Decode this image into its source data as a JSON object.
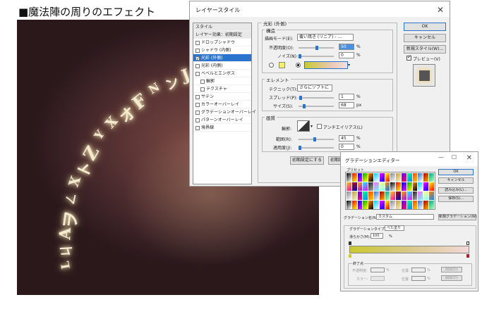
{
  "heading": "■魔法陣の周りのエフェクト",
  "photo": {
    "runes": [
      "L",
      "ㄐ",
      "A",
      "ヲ",
      "ㄥ",
      "X",
      "ト",
      "Z",
      "Y",
      "X",
      "オ",
      "F",
      "N",
      "ン",
      "J",
      "ヤ",
      "S",
      "ᐱ",
      "Y",
      "L",
      "ム"
    ]
  },
  "layer_style": {
    "title": "レイヤースタイル",
    "close": "✕",
    "sidebar": {
      "header": "スタイル",
      "subheader": "レイヤー効果：初期設定",
      "items": [
        {
          "label": "ドロップシャドウ",
          "checked": false
        },
        {
          "label": "シャドウ (内側)",
          "checked": false
        },
        {
          "label": "光彩 (外側)",
          "checked": true,
          "selected": true
        },
        {
          "label": "光彩 (内側)",
          "checked": false
        },
        {
          "label": "ベベルとエンボス",
          "checked": false
        },
        {
          "label": "輪郭",
          "checked": false,
          "indent": true
        },
        {
          "label": "テクスチャ",
          "checked": false,
          "indent": true
        },
        {
          "label": "サテン",
          "checked": false
        },
        {
          "label": "カラーオーバーレイ",
          "checked": false
        },
        {
          "label": "グラデーションオーバーレイ",
          "checked": false
        },
        {
          "label": "パターンオーバーレイ",
          "checked": false
        },
        {
          "label": "境界線",
          "checked": false
        }
      ]
    },
    "outer_glow_title": "光彩 (外側)",
    "structure": {
      "legend": "構造",
      "blend_mode_label": "描画モード(E):",
      "blend_mode_value": "覆い焼き (リニア) - ...",
      "opacity_label": "不透明度(O):",
      "opacity_value": "50",
      "noise_label": "ノイズ(N):",
      "noise_value": "0",
      "percent": "%"
    },
    "elements": {
      "legend": "エレメント",
      "technique_label": "テクニック(T):",
      "technique_value": "さらにソフトに",
      "spread_label": "スプレッド(P):",
      "spread_value": "1",
      "size_label": "サイズ(S):",
      "size_value": "68",
      "px": "px"
    },
    "quality": {
      "legend": "画質",
      "contour_label": "輪郭:",
      "antialias_label": "アンチエイリアス(L)",
      "range_label": "範囲(R):",
      "range_value": "45",
      "jitter_label": "適用度(J):",
      "jitter_value": "0",
      "percent": "%"
    },
    "buttons": {
      "make_default": "初期設定にする",
      "reset_default": "初期設定に戻す",
      "ok": "OK",
      "cancel": "キャンセル",
      "new_style": "新規スタイル(W)...",
      "preview": "プレビュー(V)"
    }
  },
  "gradient_editor": {
    "title": "グラデーションエディター",
    "minimize": "—",
    "maximize": "☐",
    "close": "✕",
    "presets_label": "プリセット",
    "ok": "OK",
    "cancel": "キャンセル",
    "load": "読み込み(L)...",
    "save": "保存(S)...",
    "name_label": "グラデーション名(N):",
    "name_value": "カスタム",
    "new_gradient": "新規グラデーション(W)",
    "type_label": "グラデーションタイプ(T):",
    "type_value": "べた塗り",
    "smooth_label": "滑らかさ(M):",
    "smooth_value": "100",
    "percent": "%",
    "stops_label": "終了点",
    "opacity_label": "不透明度:",
    "location_label": "位置:",
    "delete_label": "削除(D)",
    "color_label": "カラー:",
    "colors": {
      "accent": "#2a73cf",
      "gradient_start": "#c9c930",
      "gradient_end": "#b02020"
    }
  }
}
